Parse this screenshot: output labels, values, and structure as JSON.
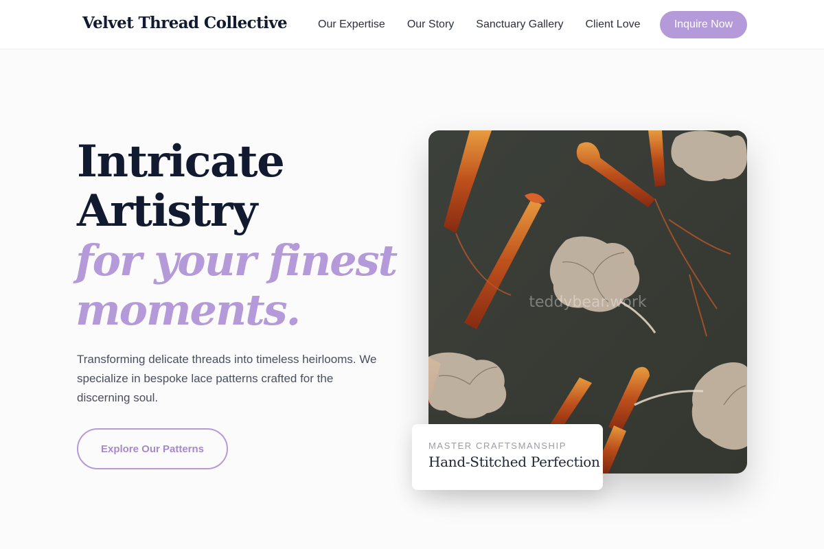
{
  "brand": {
    "name": "Velvet Thread Collective"
  },
  "nav": {
    "items": [
      {
        "label": "Our Expertise"
      },
      {
        "label": "Our Story"
      },
      {
        "label": "Sanctuary Gallery"
      },
      {
        "label": "Client Love"
      }
    ],
    "cta_label": "Inquire Now"
  },
  "hero": {
    "title_line1": "Intricate",
    "title_line2": "Artistry",
    "accent_line1": "for your finest",
    "accent_line2": "moments.",
    "description": "Transforming delicate threads into timeless heirlooms. We specialize in bespoke lace patterns crafted for the discerning soul.",
    "button_label": "Explore Our Patterns"
  },
  "image_card": {
    "watermark": "teddybear.work",
    "eyebrow": "Master Craftsmanship",
    "caption": "Hand-Stitched Perfection"
  },
  "colors": {
    "accent": "#b49ad8",
    "heading": "#111a2e",
    "background": "#fbfbfc"
  }
}
